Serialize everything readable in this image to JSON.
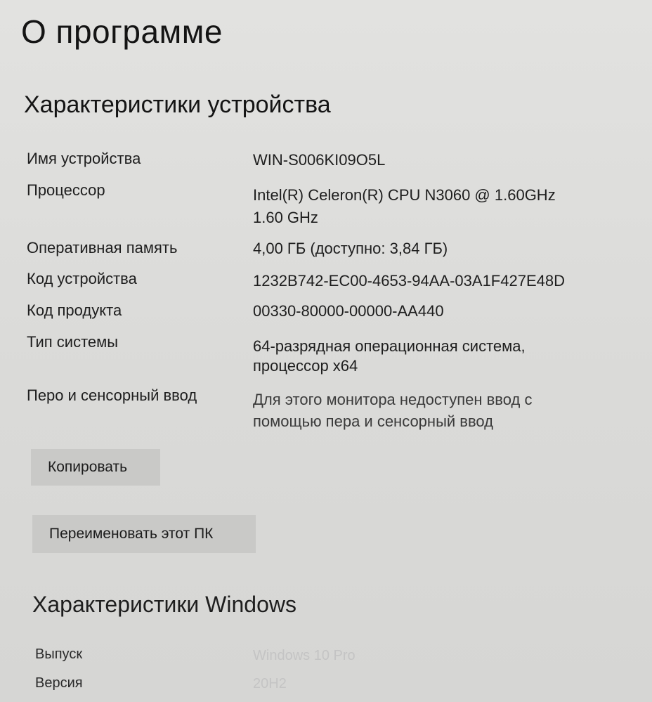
{
  "page": {
    "title": "О программе"
  },
  "device_specs": {
    "heading": "Характеристики устройства",
    "rows": [
      {
        "label": "Имя устройства",
        "value": "WIN-S006KI09O5L",
        "value2": ""
      },
      {
        "label": "Процессор",
        "value": "Intel(R) Celeron(R) CPU  N3060  @ 1.60GHz",
        "value2": "1.60 GHz"
      },
      {
        "label": "Оперативная память",
        "value": "4,00 ГБ (доступно: 3,84 ГБ)",
        "value2": ""
      },
      {
        "label": "Код устройства",
        "value": "1232B742-EC00-4653-94AA-03A1F427E48D",
        "value2": ""
      },
      {
        "label": "Код продукта",
        "value": "00330-80000-00000-AA440",
        "value2": ""
      },
      {
        "label": "Тип системы",
        "value": "64-разрядная операционная система,",
        "value2": "процессор x64"
      },
      {
        "label": "Перо и сенсорный ввод",
        "value": "Для этого монитора недоступен ввод с",
        "value2": "помощью пера и сенсорный ввод"
      }
    ]
  },
  "buttons": {
    "copy_label": "Копировать",
    "rename_label": "Переименовать этот ПК"
  },
  "windows_specs": {
    "heading": "Характеристики Windows",
    "rows": [
      {
        "label": "Выпуск",
        "value": "Windows 10 Pro"
      },
      {
        "label": "Версия",
        "value": "20H2"
      }
    ]
  }
}
